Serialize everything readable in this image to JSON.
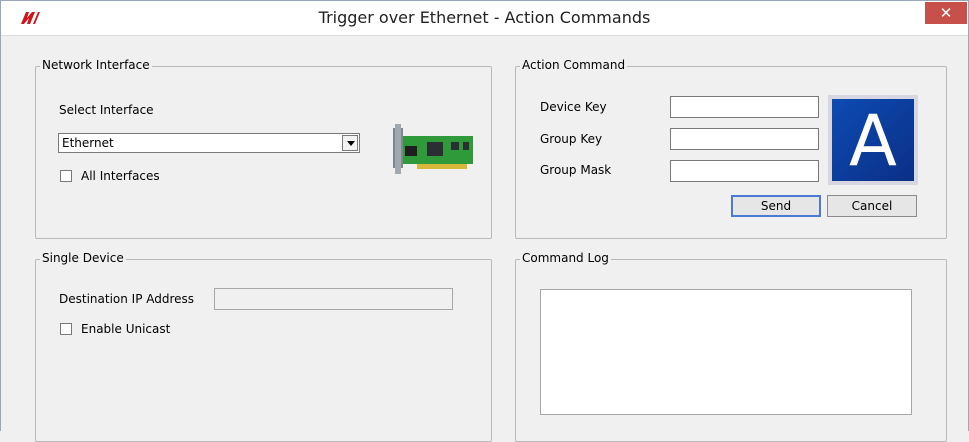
{
  "window": {
    "title": "Trigger over Ethernet - Action Commands",
    "close_label": "✕"
  },
  "network_interface": {
    "legend": "Network Interface",
    "select_label": "Select Interface",
    "selected_interface": "Ethernet",
    "all_interfaces_label": "All Interfaces",
    "all_interfaces_checked": false
  },
  "action_command": {
    "legend": "Action Command",
    "device_key_label": "Device Key",
    "device_key_value": "",
    "group_key_label": "Group Key",
    "group_key_value": "",
    "group_mask_label": "Group Mask",
    "group_mask_value": "",
    "icon_letter": "A",
    "send_label": "Send",
    "cancel_label": "Cancel"
  },
  "single_device": {
    "legend": "Single Device",
    "dest_ip_label": "Destination IP Address",
    "dest_ip_value": "",
    "enable_unicast_label": "Enable Unicast",
    "enable_unicast_checked": false
  },
  "command_log": {
    "legend": "Command Log",
    "content": ""
  },
  "colors": {
    "close_button": "#c7504a",
    "logo_red": "#d0141b",
    "a_icon_blue": "#0d4bb3",
    "nic_green": "#2e9a3a"
  }
}
